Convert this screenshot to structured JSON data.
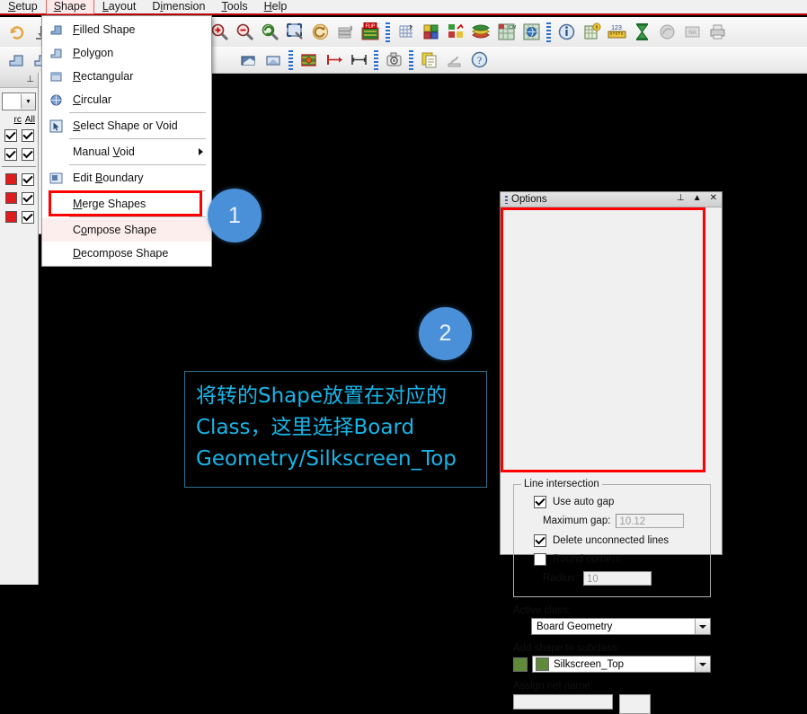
{
  "menubar": {
    "items": [
      {
        "label": "Setup",
        "active": false
      },
      {
        "label": "Shape",
        "active": true
      },
      {
        "label": "Layout",
        "active": false
      },
      {
        "label": "Dimension",
        "active": false
      },
      {
        "label": "Tools",
        "active": false
      },
      {
        "label": "Help",
        "active": false
      }
    ]
  },
  "shape_menu": {
    "items": [
      {
        "label": "Filled Shape",
        "icon": "filled-shape-icon"
      },
      {
        "label": "Polygon",
        "icon": "polygon-icon"
      },
      {
        "label": "Rectangular",
        "icon": "rectangular-icon"
      },
      {
        "label": "Circular",
        "icon": "circular-icon"
      },
      {
        "label": "Select Shape or Void",
        "icon": "select-shape-icon"
      },
      {
        "label": "Manual Void",
        "icon": "manual-void-icon",
        "submenu": true
      },
      {
        "label": "Edit Boundary",
        "icon": "edit-boundary-icon"
      },
      {
        "label": "Merge Shapes",
        "icon": "merge-shapes-icon"
      },
      {
        "label": "Compose Shape",
        "icon": "compose-shape-icon",
        "highlighted": true
      },
      {
        "label": "Decompose Shape",
        "icon": "decompose-shape-icon"
      }
    ]
  },
  "left_panel": {
    "col_headers": [
      "rc",
      "All"
    ],
    "rows": [
      {
        "swatch": null,
        "checked": true
      },
      {
        "swatch": null,
        "checked": true
      },
      {
        "swatch": "#e01b1b",
        "checked": true
      },
      {
        "swatch": "#e01b1b",
        "checked": true
      },
      {
        "swatch": "#e01b1b",
        "checked": true
      }
    ]
  },
  "options": {
    "title": "Options",
    "titlebar_buttons": [
      "pin-icon",
      "collapse-icon",
      "close-icon"
    ],
    "line_intersection": {
      "legend": "Line intersection",
      "use_auto_gap": {
        "label": "Use auto gap",
        "checked": true
      },
      "maximum_gap": {
        "label": "Maximum gap:",
        "value": "10.12"
      },
      "delete_unconnected": {
        "label": "Delete unconnected lines",
        "checked": true
      },
      "round_corners": {
        "label": "Round corners",
        "checked": false
      },
      "radius": {
        "label": "Radius:",
        "value": "10"
      }
    },
    "active_class": {
      "label": "Active class:",
      "value": "Board Geometry"
    },
    "subclass": {
      "label": "Add shape to subclass:",
      "value": "Silkscreen_Top",
      "color": "#5e8a3a"
    },
    "assign_net": {
      "label": "Assign net name:",
      "value": ""
    }
  },
  "annotation": {
    "lines": [
      "将转的Shape放置在对应的",
      "Class，这里选择Board",
      "Geometry/Silkscreen_Top"
    ],
    "color": "#19b5e8"
  },
  "badges": [
    {
      "number": "1"
    },
    {
      "number": "2"
    }
  ],
  "colors": {
    "highlight_red": "#ff0000",
    "badge_blue": "#4a90d9",
    "annotation_cyan": "#19b5e8",
    "canvas": "#000000",
    "chrome": "#f0f0f0"
  }
}
